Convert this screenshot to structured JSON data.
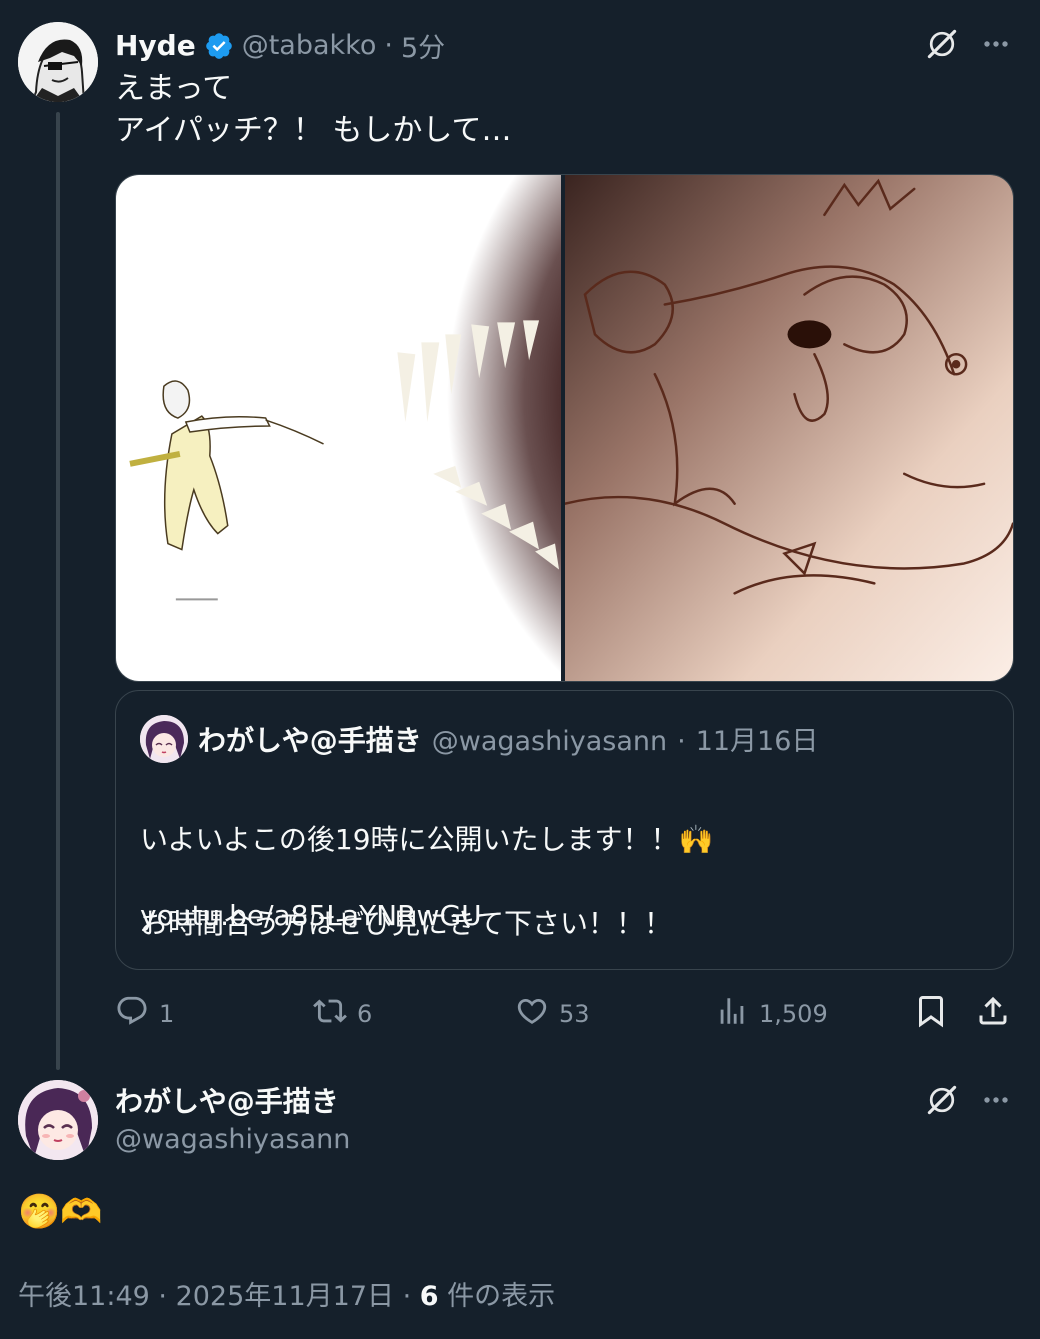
{
  "tweet1": {
    "name": "Hyde",
    "handle": "@tabakko",
    "time": "5分",
    "text_line1": "えまって",
    "text_line2": "アイパッチ？！ もしかして…"
  },
  "quote": {
    "name": "わがしや@手描き",
    "handle": "@wagashiyasann",
    "date": "11月16日",
    "text_line1": "いよいよこの後19時に公開いたします！！🙌",
    "text_line2": "お時間合う方はぜひ見にきて下さい！！！",
    "link": "youtu.be/a85LaYNRwGU"
  },
  "actions": {
    "replies": "1",
    "reposts": "6",
    "likes": "53",
    "views": "1,509"
  },
  "tweet2": {
    "name": "わがしや@手描き",
    "handle": "@wagashiyasann",
    "text": "🤭🫶",
    "time": "午後11:49",
    "date": "2025年11月17日",
    "views_count": "6",
    "views_label": "件の表示"
  },
  "colors": {
    "background": "#15202b",
    "muted": "#8b98a5",
    "verified": "#1d9bf0",
    "border": "#38444d"
  },
  "icons": [
    "verified-badge-icon",
    "grok-icon",
    "more-icon",
    "reply-icon",
    "repost-icon",
    "like-icon",
    "views-icon",
    "bookmark-icon",
    "share-icon"
  ]
}
